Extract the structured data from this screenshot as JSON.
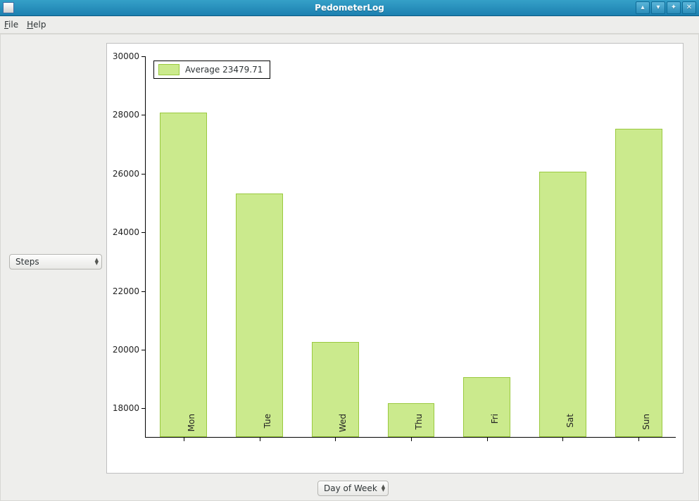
{
  "window": {
    "title": "PedometerLog"
  },
  "menu": {
    "file": "File",
    "help": "Help"
  },
  "controls": {
    "y_selector": "Steps",
    "x_selector": "Day of Week"
  },
  "legend": {
    "label": "Average 23479.71"
  },
  "yaxis": {
    "ticks": [
      "18000",
      "20000",
      "22000",
      "24000",
      "26000",
      "28000",
      "30000"
    ]
  },
  "xaxis": {
    "labels": [
      "Mon",
      "Tue",
      "Wed",
      "Thu",
      "Fri",
      "Sat",
      "Sun"
    ]
  },
  "chart_data": {
    "type": "bar",
    "title": "",
    "xlabel": "Day of Week",
    "ylabel": "Steps",
    "ylim": [
      17000,
      30000
    ],
    "categories": [
      "Mon",
      "Tue",
      "Wed",
      "Thu",
      "Fri",
      "Sat",
      "Sun"
    ],
    "values": [
      28050,
      25300,
      20250,
      18150,
      19050,
      26050,
      27500
    ],
    "series": [
      {
        "name": "Average 23479.71",
        "values": [
          28050,
          25300,
          20250,
          18150,
          19050,
          26050,
          27500
        ]
      }
    ],
    "legend_position": "upper-left",
    "grid": false,
    "bar_color": "#cbea8d",
    "bar_edge_color": "#9ac93f"
  }
}
